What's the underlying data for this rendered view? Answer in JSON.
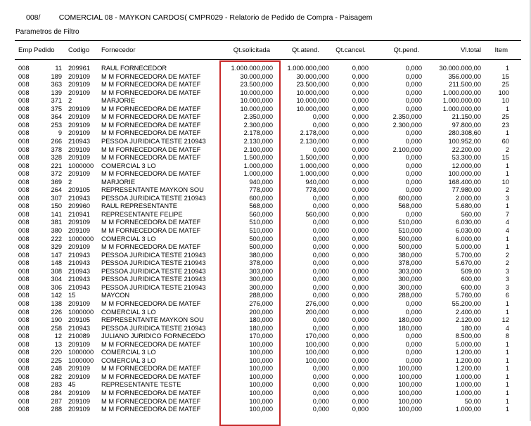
{
  "header": {
    "title": "008/         COMERCIAL 08 - MAYKON CARDOS( CMPR029 - Relatorio de Pedido de Compra - Paisagem",
    "filter_label": "Parametros de Filtro"
  },
  "columns": {
    "emp": "Emp.",
    "pedido": "Pedido",
    "codigo": "Codigo",
    "fornecedor": "Fornecedor",
    "qt_solicitada": "Qt.solicitada",
    "qt_atend": "Qt.atend.",
    "qt_cancel": "Qt.cancel.",
    "qt_pend": "Qt.pend.",
    "vl_total": "Vl.total",
    "item": "Item"
  },
  "highlight_color": "#c62828",
  "rows": [
    [
      "008",
      "11",
      "209961",
      "RAUL FORNECEDOR",
      "1.000.000,000",
      "1.000.000,000",
      "0,000",
      "0,000",
      "30.000.000,00",
      "1"
    ],
    [
      "008",
      "189",
      "209109",
      "M M   FORNECEDORA DE MATEF",
      "30.000,000",
      "30.000,000",
      "0,000",
      "0,000",
      "356.000,00",
      "15"
    ],
    [
      "008",
      "363",
      "209109",
      "M M   FORNECEDORA DE MATEF",
      "23.500,000",
      "23.500,000",
      "0,000",
      "0,000",
      "211.500,00",
      "25"
    ],
    [
      "008",
      "139",
      "209109",
      "M M   FORNECEDORA DE MATEF",
      "10.000,000",
      "10.000,000",
      "0,000",
      "0,000",
      "1.000.000,00",
      "100"
    ],
    [
      "008",
      "371",
      "2",
      "MARJORIE",
      "10.000,000",
      "10.000,000",
      "0,000",
      "0,000",
      "1.000.000,00",
      "10"
    ],
    [
      "008",
      "375",
      "209109",
      "M M   FORNECEDORA DE MATEF",
      "10.000,000",
      "10.000,000",
      "0,000",
      "0,000",
      "1.000.000,00",
      "1"
    ],
    [
      "008",
      "364",
      "209109",
      "M M   FORNECEDORA DE MATEF",
      "2.350,000",
      "0,000",
      "0,000",
      "2.350,000",
      "21.150,00",
      "25"
    ],
    [
      "008",
      "253",
      "209109",
      "M M   FORNECEDORA DE MATEF",
      "2.300,000",
      "0,000",
      "0,000",
      "2.300,000",
      "97.800,00",
      "23"
    ],
    [
      "008",
      "9",
      "209109",
      "M M   FORNECEDORA DE MATEF",
      "2.178,000",
      "2.178,000",
      "0,000",
      "0,000",
      "280.308,60",
      "1"
    ],
    [
      "008",
      "266",
      "210943",
      "PESSOA JURIDICA TESTE 210943",
      "2.130,000",
      "2.130,000",
      "0,000",
      "0,000",
      "100.952,00",
      "60"
    ],
    [
      "008",
      "378",
      "209109",
      "M M   FORNECEDORA DE MATEF",
      "2.100,000",
      "0,000",
      "0,000",
      "2.100,000",
      "22.200,00",
      "2"
    ],
    [
      "008",
      "328",
      "209109",
      "M M   FORNECEDORA DE MATEF",
      "1.500,000",
      "1.500,000",
      "0,000",
      "0,000",
      "53.300,00",
      "15"
    ],
    [
      "008",
      "221",
      "1000000",
      "COMERCIAL 3 LO",
      "1.000,000",
      "1.000,000",
      "0,000",
      "0,000",
      "12.000,00",
      "1"
    ],
    [
      "008",
      "372",
      "209109",
      "M M   FORNECEDORA DE MATEF",
      "1.000,000",
      "1.000,000",
      "0,000",
      "0,000",
      "100.000,00",
      "1"
    ],
    [
      "008",
      "369",
      "2",
      "MARJORIE",
      "940,000",
      "940,000",
      "0,000",
      "0,000",
      "168.400,00",
      "10"
    ],
    [
      "008",
      "264",
      "209105",
      "REPRESENTANTE MAYKON SOU",
      "778,000",
      "778,000",
      "0,000",
      "0,000",
      "77.980,00",
      "2"
    ],
    [
      "008",
      "307",
      "210943",
      "PESSOA JURIDICA TESTE 210943",
      "600,000",
      "0,000",
      "0,000",
      "600,000",
      "2.000,00",
      "3"
    ],
    [
      "008",
      "150",
      "209960",
      "RAUL REPRESENTANTE",
      "568,000",
      "0,000",
      "0,000",
      "568,000",
      "5.680,00",
      "1"
    ],
    [
      "008",
      "141",
      "210941",
      "REPRESENTANTE FELIPE",
      "560,000",
      "560,000",
      "0,000",
      "0,000",
      "560,00",
      "7"
    ],
    [
      "008",
      "381",
      "209109",
      "M M   FORNECEDORA DE MATEF",
      "510,000",
      "0,000",
      "0,000",
      "510,000",
      "6.030,00",
      "4"
    ],
    [
      "008",
      "380",
      "209109",
      "M M   FORNECEDORA DE MATEF",
      "510,000",
      "0,000",
      "0,000",
      "510,000",
      "6.030,00",
      "4"
    ],
    [
      "008",
      "222",
      "1000000",
      "COMERCIAL 3 LO",
      "500,000",
      "0,000",
      "0,000",
      "500,000",
      "6.000,00",
      "1"
    ],
    [
      "008",
      "329",
      "209109",
      "M M   FORNECEDORA DE MATEF",
      "500,000",
      "0,000",
      "0,000",
      "500,000",
      "5.000,00",
      "1"
    ],
    [
      "008",
      "147",
      "210943",
      "PESSOA JURIDICA TESTE 210943",
      "380,000",
      "0,000",
      "0,000",
      "380,000",
      "5.700,00",
      "2"
    ],
    [
      "008",
      "148",
      "210943",
      "PESSOA JURIDICA TESTE 210943",
      "378,000",
      "0,000",
      "0,000",
      "378,000",
      "5.670,00",
      "2"
    ],
    [
      "008",
      "308",
      "210943",
      "PESSOA JURIDICA TESTE 210943",
      "303,000",
      "0,000",
      "0,000",
      "303,000",
      "509,00",
      "3"
    ],
    [
      "008",
      "304",
      "210943",
      "PESSOA JURIDICA TESTE 210943",
      "300,000",
      "0,000",
      "0,000",
      "300,000",
      "600,00",
      "3"
    ],
    [
      "008",
      "306",
      "210943",
      "PESSOA JURIDICA TESTE 210943",
      "300,000",
      "0,000",
      "0,000",
      "300,000",
      "600,00",
      "3"
    ],
    [
      "008",
      "142",
      "15",
      "MAYCON",
      "288,000",
      "0,000",
      "0,000",
      "288,000",
      "5.760,00",
      "6"
    ],
    [
      "008",
      "138",
      "209109",
      "M M   FORNECEDORA DE MATEF",
      "276,000",
      "276,000",
      "0,000",
      "0,000",
      "55.200,00",
      "1"
    ],
    [
      "008",
      "226",
      "1000000",
      "COMERCIAL 3 LO",
      "200,000",
      "200,000",
      "0,000",
      "0,000",
      "2.400,00",
      "1"
    ],
    [
      "008",
      "190",
      "209105",
      "REPRESENTANTE MAYKON SOU",
      "180,000",
      "0,000",
      "0,000",
      "180,000",
      "2.120,00",
      "12"
    ],
    [
      "008",
      "258",
      "210943",
      "PESSOA JURIDICA TESTE 210943",
      "180,000",
      "0,000",
      "0,000",
      "180,000",
      "180,00",
      "4"
    ],
    [
      "008",
      "12",
      "210089",
      "JULIANO JURIDICO FORNECEDO",
      "170,000",
      "170,000",
      "0,000",
      "0,000",
      "8.500,00",
      "8"
    ],
    [
      "008",
      "13",
      "209109",
      "M M   FORNECEDORA DE MATEF",
      "100,000",
      "100,000",
      "0,000",
      "0,000",
      "5.000,00",
      "1"
    ],
    [
      "008",
      "220",
      "1000000",
      "COMERCIAL 3 LO",
      "100,000",
      "100,000",
      "0,000",
      "0,000",
      "1.200,00",
      "1"
    ],
    [
      "008",
      "225",
      "1000000",
      "COMERCIAL 3 LO",
      "100,000",
      "100,000",
      "0,000",
      "0,000",
      "1.200,00",
      "1"
    ],
    [
      "008",
      "248",
      "209109",
      "M M   FORNECEDORA DE MATEF",
      "100,000",
      "0,000",
      "0,000",
      "100,000",
      "1.200,00",
      "1"
    ],
    [
      "008",
      "282",
      "209109",
      "M M   FORNECEDORA DE MATEF",
      "100,000",
      "0,000",
      "0,000",
      "100,000",
      "1.000,00",
      "1"
    ],
    [
      "008",
      "283",
      "45",
      "REPRESENTANTE TESTE",
      "100,000",
      "0,000",
      "0,000",
      "100,000",
      "1.000,00",
      "1"
    ],
    [
      "008",
      "284",
      "209109",
      "M M   FORNECEDORA DE MATEF",
      "100,000",
      "0,000",
      "0,000",
      "100,000",
      "1.000,00",
      "1"
    ],
    [
      "008",
      "287",
      "209109",
      "M M   FORNECEDORA DE MATEF",
      "100,000",
      "0,000",
      "0,000",
      "100,000",
      "50,00",
      "1"
    ],
    [
      "008",
      "288",
      "209109",
      "M M   FORNECEDORA DE MATEF",
      "100,000",
      "0,000",
      "0,000",
      "100,000",
      "1.000,00",
      "1"
    ]
  ]
}
